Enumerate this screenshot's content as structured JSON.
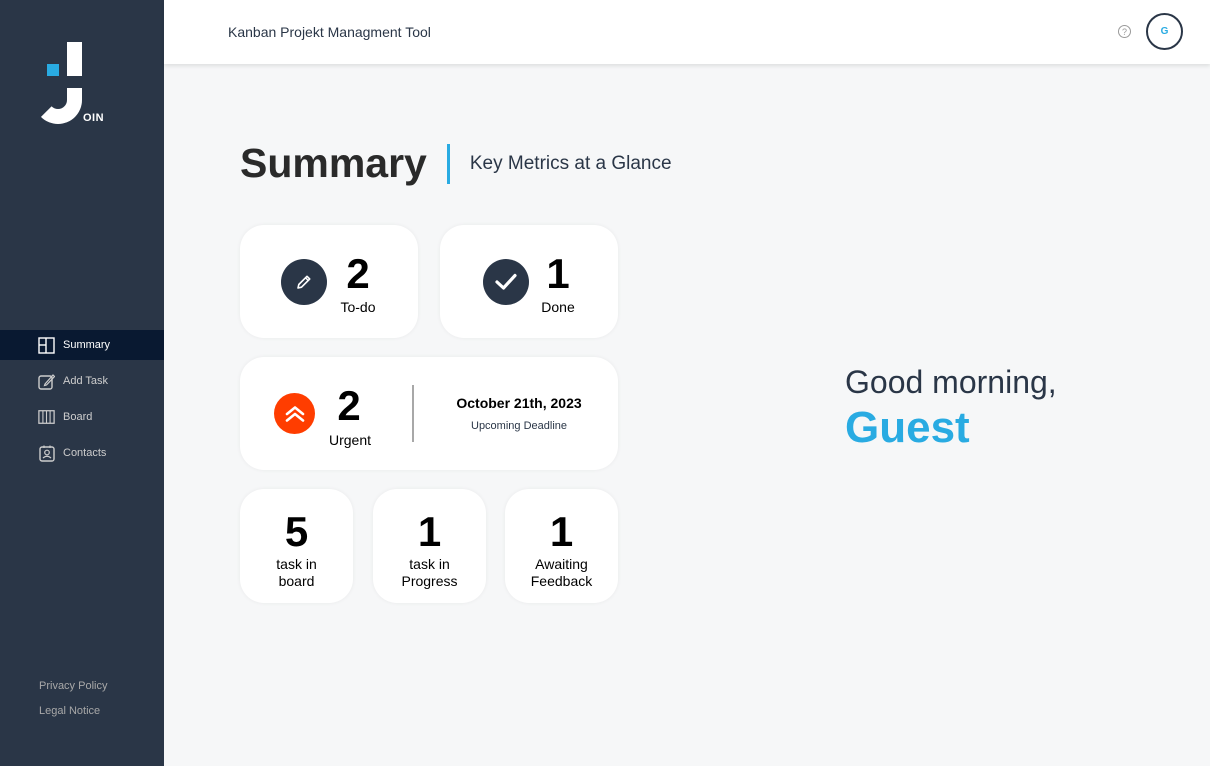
{
  "app": {
    "name": "JOIN",
    "logo_suffix": "OIN",
    "header_title": "Kanban Projekt Managment Tool"
  },
  "header": {
    "help_icon": "?",
    "avatar_initial": "G"
  },
  "sidebar": {
    "items": [
      {
        "label": "Summary",
        "icon": "summary-icon",
        "active": true
      },
      {
        "label": "Add Task",
        "icon": "add-task-icon",
        "active": false
      },
      {
        "label": "Board",
        "icon": "board-icon",
        "active": false
      },
      {
        "label": "Contacts",
        "icon": "contacts-icon",
        "active": false
      }
    ],
    "footer_links": [
      "Privacy Policy",
      "Legal Notice"
    ]
  },
  "summary": {
    "title": "Summary",
    "subtitle": "Key Metrics at a Glance",
    "todo": {
      "count": "2",
      "label": "To-do"
    },
    "done": {
      "count": "1",
      "label": "Done"
    },
    "urgent": {
      "count": "2",
      "label": "Urgent",
      "deadline_date": "October 21th, 2023",
      "deadline_label": "Upcoming Deadline"
    },
    "board": {
      "count": "5",
      "label_line1": "task in",
      "label_line2": "board"
    },
    "progress": {
      "count": "1",
      "label_line1": "task in",
      "label_line2": "Progress"
    },
    "feedback": {
      "count": "1",
      "label_line1": "Awaiting",
      "label_line2": "Feedback"
    }
  },
  "greeting": {
    "line": "Good morning,",
    "name": "Guest"
  },
  "colors": {
    "sidebar": "#2a3647",
    "accent": "#29abe2",
    "urgent": "#ff3d00",
    "active_nav": "#091931"
  }
}
